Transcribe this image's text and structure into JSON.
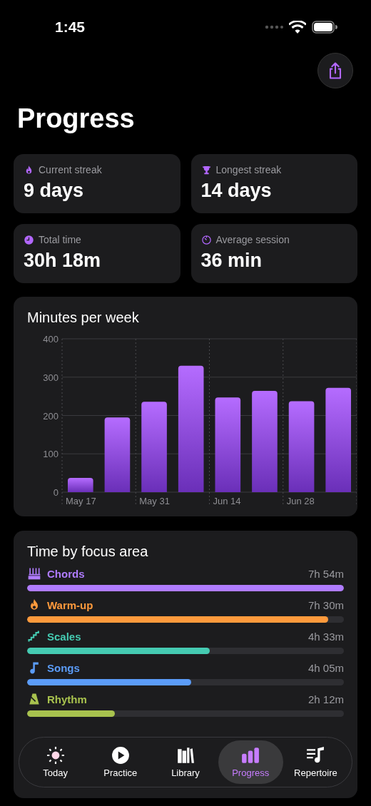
{
  "status_bar": {
    "time": "1:45"
  },
  "title": "Progress",
  "stats": [
    {
      "kind": "flame",
      "label": "Current streak",
      "value": "9 days"
    },
    {
      "kind": "trophy",
      "label": "Longest streak",
      "value": "14 days"
    },
    {
      "kind": "clock",
      "label": "Total time",
      "value": "30h 18m"
    },
    {
      "kind": "timer",
      "label": "Average session",
      "value": "36 min"
    }
  ],
  "weekly_chart": {
    "chart_data": {
      "type": "bar",
      "title": "Minutes per week",
      "categories": [
        "May 17",
        null,
        "May 31",
        null,
        "Jun 14",
        null,
        "Jun 28",
        null
      ],
      "values": [
        37,
        195,
        236,
        330,
        247,
        264,
        237,
        272
      ],
      "ylim": [
        0,
        400
      ],
      "grid": true,
      "yticks": [
        0,
        100,
        200,
        300,
        400
      ]
    }
  },
  "focus": {
    "title": "Time by focus area",
    "areas": [
      {
        "kind": "chords",
        "name": "Chords",
        "time": "7h 54m",
        "level": 1.0,
        "color": "#b07cff"
      },
      {
        "kind": "flame",
        "name": "Warm-up",
        "time": "7h 30m",
        "level": 0.95,
        "color": "#ff9a3c"
      },
      {
        "kind": "stairs",
        "name": "Scales",
        "time": "4h 33m",
        "level": 0.576,
        "color": "#45cbb2"
      },
      {
        "kind": "note",
        "name": "Songs",
        "time": "4h 05m",
        "level": 0.517,
        "color": "#5b9cf8"
      },
      {
        "kind": "metronome",
        "name": "Rhythm",
        "time": "2h 12m",
        "level": 0.278,
        "color": "#a8c24e"
      }
    ]
  },
  "tab_bar": [
    {
      "kind": "sun",
      "label": "Today",
      "selected": false
    },
    {
      "kind": "play",
      "label": "Practice",
      "selected": false
    },
    {
      "kind": "books",
      "label": "Library",
      "selected": false
    },
    {
      "kind": "bars",
      "label": "Progress",
      "selected": true
    },
    {
      "kind": "music-list",
      "label": "Repertoire",
      "selected": false
    }
  ]
}
